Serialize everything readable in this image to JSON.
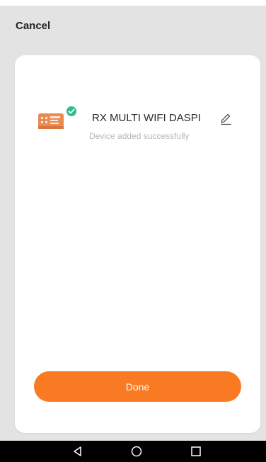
{
  "header": {
    "cancel_label": "Cancel"
  },
  "device": {
    "name": "RX MULTI WIFI DASPI",
    "status": "Device added successfully",
    "thumbnail_icon": "device-module-icon",
    "badge_icon": "check-circle-icon",
    "edit_icon": "pencil-icon"
  },
  "actions": {
    "done_label": "Done"
  },
  "system_nav": {
    "items": [
      "back-icon",
      "home-icon",
      "recents-icon"
    ]
  },
  "colors": {
    "accent": "#f97a23",
    "success": "#2bbf8a",
    "background": "#e3e3e3",
    "card": "#ffffff",
    "muted_text": "#b7b7b7",
    "nav_bar": "#000000"
  }
}
